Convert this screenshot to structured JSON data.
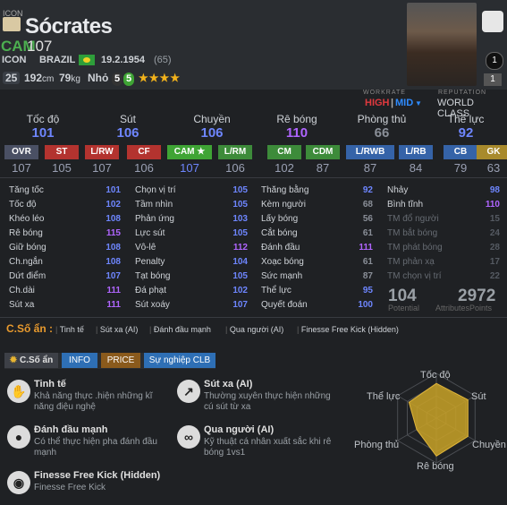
{
  "player": {
    "icon_label": "ICON",
    "name": "Sócrates",
    "position": "CAM",
    "ovr": "107",
    "type": "ICON",
    "nation": "BRAZIL",
    "dob": "19.2.1954",
    "age": "(65)",
    "level": "25",
    "height": "192",
    "height_unit": "cm",
    "weight": "79",
    "weight_unit": "kg",
    "body": "Nhỏ",
    "weak_foot": "5",
    "strong_foot": "5",
    "stars": "★★★★",
    "chem_top": "1",
    "chem_bottom": "1"
  },
  "workrate": {
    "label": "WORKRATE",
    "high": "HIGH",
    "sep": "|",
    "mid": "MID",
    "mid_arrow": "▼",
    "rep_label": "REPUTATION",
    "rep": "WORLD CLASS"
  },
  "main_stats": [
    {
      "label": "Tốc độ",
      "value": "101"
    },
    {
      "label": "Sút",
      "value": "106"
    },
    {
      "label": "Chuyền",
      "value": "106"
    },
    {
      "label": "Rê bóng",
      "value": "110"
    },
    {
      "label": "Phòng thủ",
      "value": "66"
    },
    {
      "label": "Thể lực",
      "value": "92"
    }
  ],
  "positions": [
    {
      "label": "OVR",
      "value": "107",
      "color": "#4a5064"
    },
    {
      "label": "ST",
      "value": "105",
      "color": "#b3332f"
    },
    {
      "label": "L/RW",
      "value": "107",
      "color": "#b3332f"
    },
    {
      "label": "CF",
      "value": "106",
      "color": "#b3332f"
    },
    {
      "label": "CAM",
      "value": "107",
      "color": "#3fa435"
    },
    {
      "label": "L/RM",
      "value": "106",
      "color": "#3d8b3a"
    },
    {
      "label": "CM",
      "value": "102",
      "color": "#3d8b3a"
    },
    {
      "label": "CDM",
      "value": "87",
      "color": "#3d8b3a"
    },
    {
      "label": "L/RWB",
      "value": "87",
      "color": "#3563a8"
    },
    {
      "label": "L/RB",
      "value": "84",
      "color": "#3563a8"
    },
    {
      "label": "CB",
      "value": "79",
      "color": "#3563a8"
    },
    {
      "label": "GK",
      "value": "63",
      "color": "#a88a2c"
    }
  ],
  "stats_col1": [
    {
      "label": "Tăng tốc",
      "value": "101"
    },
    {
      "label": "Tốc độ",
      "value": "102"
    },
    {
      "label": "Khéo léo",
      "value": "108"
    },
    {
      "label": "Rê bóng",
      "value": "115"
    },
    {
      "label": "Giữ bóng",
      "value": "108"
    },
    {
      "label": "Ch.ngắn",
      "value": "108"
    },
    {
      "label": "Dứt điểm",
      "value": "107"
    },
    {
      "label": "Ch.dài",
      "value": "111"
    },
    {
      "label": "Sút xa",
      "value": "111"
    }
  ],
  "stats_col2": [
    {
      "label": "Chọn vị trí",
      "value": "105"
    },
    {
      "label": "Tầm nhìn",
      "value": "105"
    },
    {
      "label": "Phản ứng",
      "value": "103"
    },
    {
      "label": "Lực sút",
      "value": "105"
    },
    {
      "label": "Vô-lê",
      "value": "112"
    },
    {
      "label": "Penalty",
      "value": "104"
    },
    {
      "label": "Tạt bóng",
      "value": "105"
    },
    {
      "label": "Đá phạt",
      "value": "102"
    },
    {
      "label": "Sút xoáy",
      "value": "107"
    }
  ],
  "stats_col3": [
    {
      "label": "Thăng bằng",
      "value": "92"
    },
    {
      "label": "Kèm người",
      "value": "68"
    },
    {
      "label": "Lấy bóng",
      "value": "56"
    },
    {
      "label": "Cắt bóng",
      "value": "61"
    },
    {
      "label": "Đánh đầu",
      "value": "111"
    },
    {
      "label": "Xoạc bóng",
      "value": "61"
    },
    {
      "label": "Sức mạnh",
      "value": "87"
    },
    {
      "label": "Thể lực",
      "value": "95"
    },
    {
      "label": "Quyết đoán",
      "value": "100"
    }
  ],
  "stats_col4": [
    {
      "label": "Nhảy",
      "value": "98"
    },
    {
      "label": "Bình tĩnh",
      "value": "110"
    },
    {
      "label": "TM đổ người",
      "value": "15"
    },
    {
      "label": "TM bắt bóng",
      "value": "24"
    },
    {
      "label": "TM phát bóng",
      "value": "28"
    },
    {
      "label": "TM phản xạ",
      "value": "17"
    },
    {
      "label": "TM chọn vị trí",
      "value": "22"
    }
  ],
  "totals": {
    "potential": "104",
    "potential_label": "Potential",
    "attributes": "2972",
    "attributes_label": "AttributesPoints"
  },
  "traits_bar": {
    "label": "C.Số ẩn :",
    "items": [
      "Tinh tế",
      "Sút xa (AI)",
      "Đánh đầu mạnh",
      "Qua người (AI)",
      "Finesse Free Kick (Hidden)"
    ]
  },
  "tabs": [
    "C.Số ẩn",
    "INFO",
    "PRICE",
    "Sự nghiệp CLB"
  ],
  "traits": [
    {
      "title": "Tinh tế",
      "desc": "Khả năng thực .hiện những kĩ năng điệu nghệ",
      "icon": "ball-skill-icon"
    },
    {
      "title": "Sút xa (AI)",
      "desc": "Thường xuyên thực hiện những cú sút từ xa",
      "icon": "long-shot-icon"
    },
    {
      "title": "Đánh đầu mạnh",
      "desc": "Có thể thực hiện pha đánh đầu mạnh",
      "icon": "header-icon"
    },
    {
      "title": "Qua người (AI)",
      "desc": "Kỹ thuật cá nhân xuất sắc khi rê bóng 1vs1",
      "icon": "dribble-icon"
    },
    {
      "title": "Finesse Free Kick (Hidden)",
      "desc": "Finesse Free Kick",
      "icon": "free-kick-icon"
    }
  ],
  "radar": {
    "labels": [
      "Tốc độ",
      "Sút",
      "Chuyền",
      "Rê bóng",
      "Phòng thủ",
      "Thể lực"
    ],
    "values": [
      101,
      106,
      106,
      110,
      66,
      92
    ]
  },
  "colors": {
    "accent_green": "#4caf50",
    "stat_blue": "#6e86ff",
    "stat_purple": "#b065ff",
    "stat_gray": "#8a8f98",
    "tab_active": "#3d4047",
    "tab_blue": "#2e6fb5",
    "tab_orange": "#8a5a1c",
    "radar_yellow": "#c9a227"
  }
}
